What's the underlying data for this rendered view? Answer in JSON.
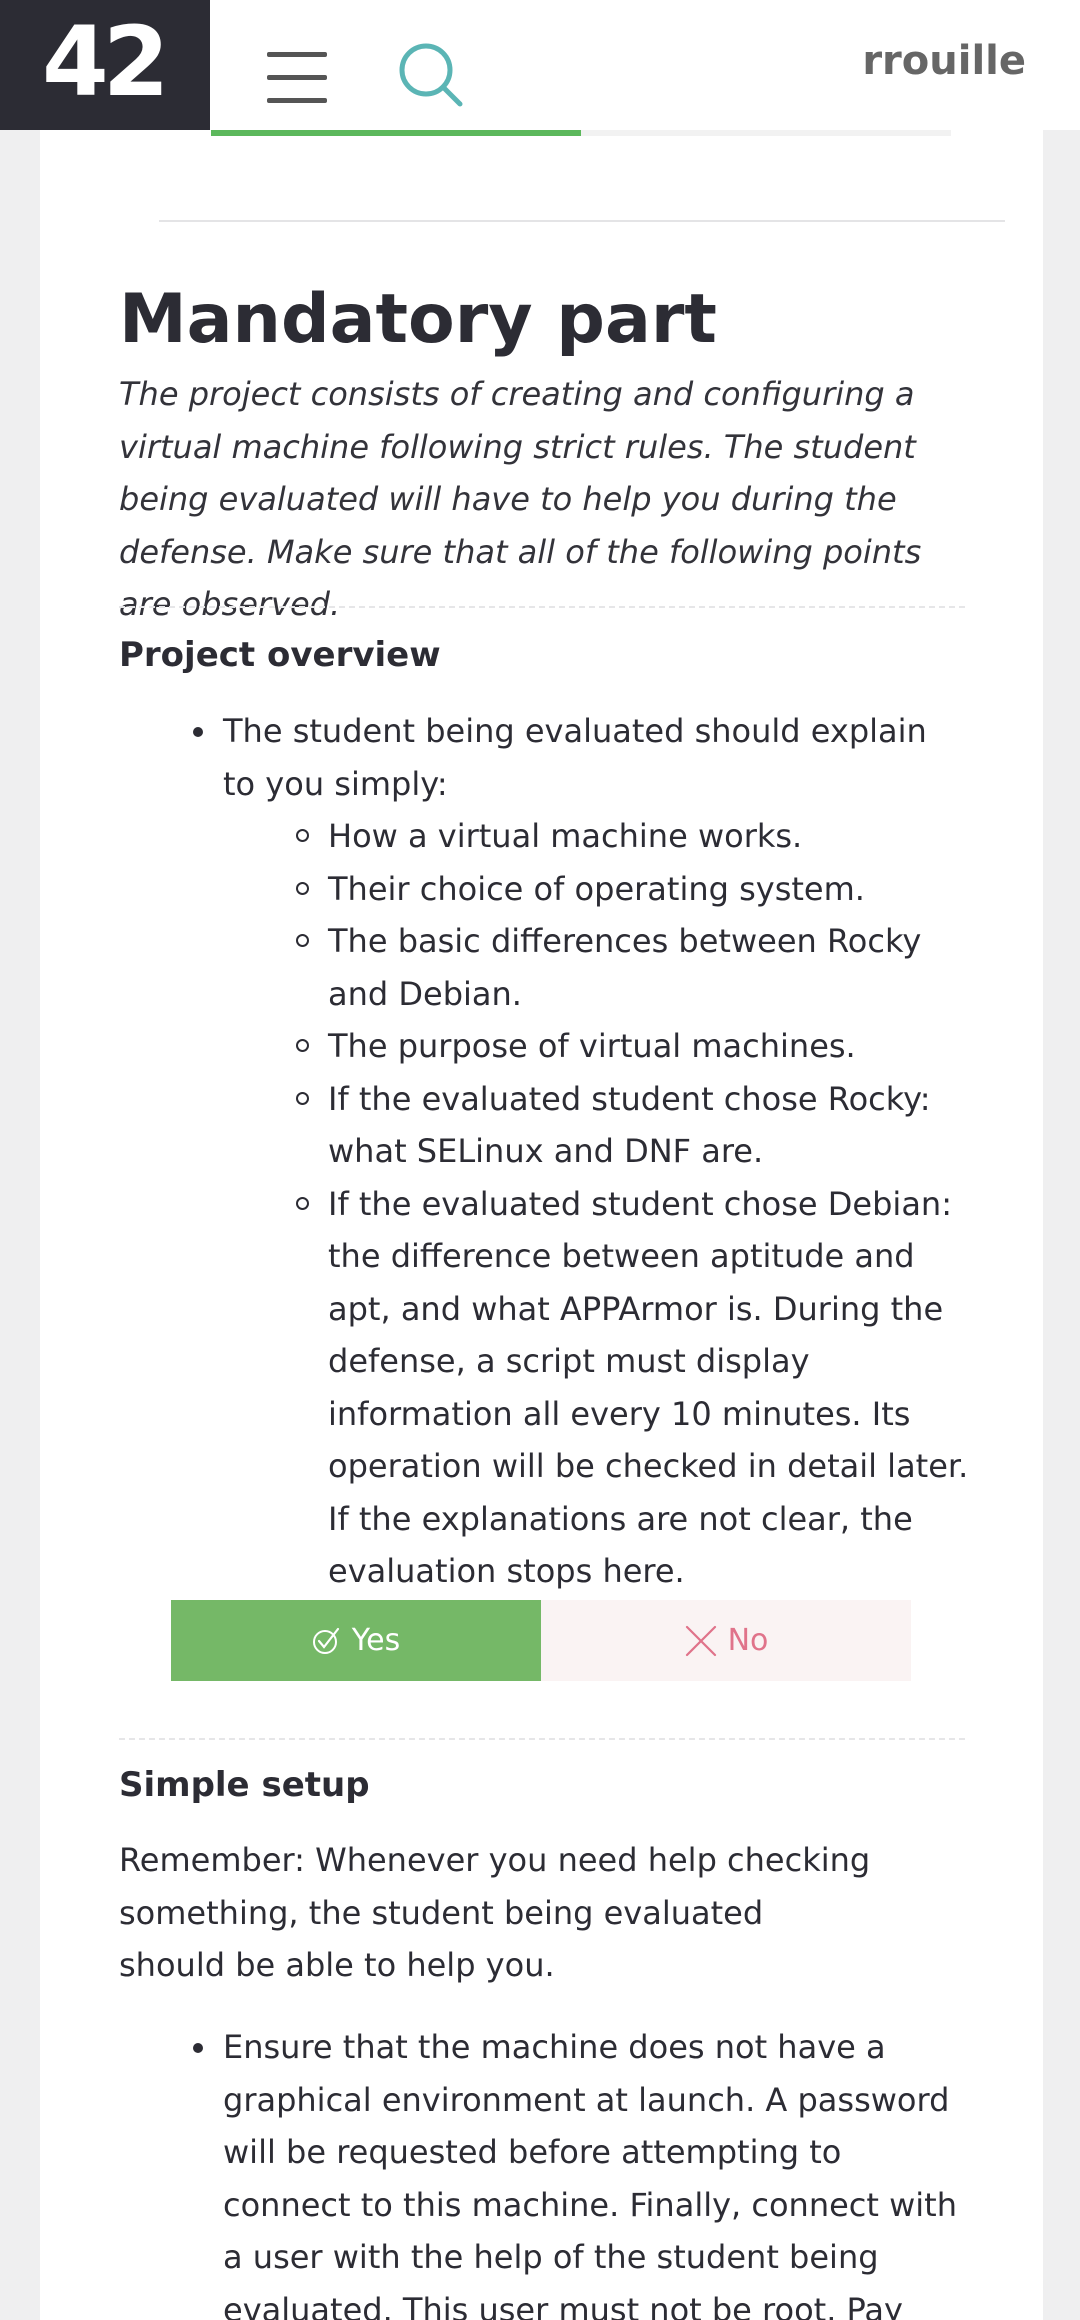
{
  "header": {
    "logo": "42",
    "username": "rrouille"
  },
  "section": {
    "title": "Mandatory part",
    "intro": "The project consists of creating and configuring a virtual machine following strict rules. The student being evaluated will have to help you during the defense. Make sure that all of the following points are observed."
  },
  "overview": {
    "title": "Project overview",
    "item": "The student being evaluated should explain to you simply:",
    "subitems": [
      "How a virtual machine works.",
      "Their choice of operating system.",
      "The basic differences between Rocky and Debian.",
      "The purpose of virtual machines.",
      "If the evaluated student chose Rocky: what SELinux and DNF are.",
      "If the evaluated student chose Debian: the difference between aptitude and apt, and what APPArmor is. During the defense, a script must display information all every 10 minutes. Its operation will be checked in detail later. If the explanations are not clear, the evaluation stops here."
    ],
    "yes_label": "Yes",
    "no_label": "No"
  },
  "setup": {
    "title": "Simple setup",
    "remember_line1": "Remember: Whenever you need help checking something, the student being evaluated",
    "remember_line2": "should be able to help you.",
    "item": "Ensure that the machine does not have a graphical environment at launch. A password will be requested before attempting to connect to this machine. Finally, connect with a user with the help of the student being evaluated. This user must not be root. Pay attention to the password chosen, it must"
  },
  "progress": {
    "filled_fraction": 0.5
  },
  "colors": {
    "yes_bg": "#75b867",
    "no_bg": "#faf3f3",
    "no_text": "#e0738a",
    "search_icon": "#5bb5b5",
    "logo_bg": "#2c2c34"
  }
}
